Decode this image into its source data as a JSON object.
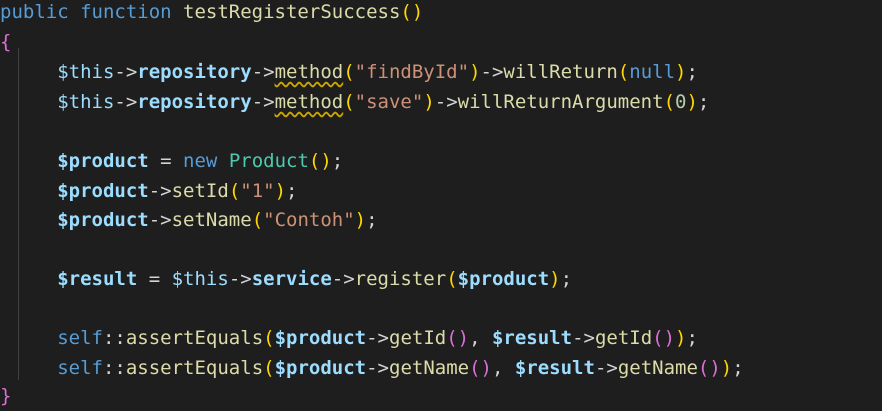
{
  "code": {
    "signature": {
      "kw": "public function",
      "name": "testRegisterSuccess",
      "parens": "()"
    },
    "open_brace": "{",
    "close_brace": "}",
    "l1": {
      "this": "$this",
      "arrow1": "->",
      "repo": "repository",
      "arrow2": "->",
      "method": "method",
      "open": "(",
      "str": "\"findById\"",
      "close": ")",
      "arrow3": "->",
      "call": "willReturn",
      "open2": "(",
      "arg": "null",
      "close2": ")",
      "semi": ";"
    },
    "l2": {
      "this": "$this",
      "arrow1": "->",
      "repo": "repository",
      "arrow2": "->",
      "method": "method",
      "open": "(",
      "str": "\"save\"",
      "close": ")",
      "arrow3": "->",
      "call": "willReturnArgument",
      "open2": "(",
      "arg": "0",
      "close2": ")",
      "semi": ";"
    },
    "l3": {
      "var": "$product",
      "eq": " = ",
      "kw": "new",
      "cls": "Product",
      "parens": "()",
      "semi": ";"
    },
    "l4": {
      "var": "$product",
      "arrow": "->",
      "call": "setId",
      "open": "(",
      "str": "\"1\"",
      "close": ")",
      "semi": ";"
    },
    "l5": {
      "var": "$product",
      "arrow": "->",
      "call": "setName",
      "open": "(",
      "str": "\"Contoh\"",
      "close": ")",
      "semi": ";"
    },
    "l6": {
      "var": "$result",
      "eq": " = ",
      "this": "$this",
      "arrow1": "->",
      "svc": "service",
      "arrow2": "->",
      "call": "register",
      "open": "(",
      "arg": "$product",
      "close": ")",
      "semi": ";"
    },
    "l7": {
      "self": "self",
      "dc": "::",
      "call": "assertEquals",
      "open": "(",
      "v1": "$product",
      "a1": "->",
      "m1": "getId",
      "p1": "()",
      "comma": ", ",
      "v2": "$result",
      "a2": "->",
      "m2": "getId",
      "p2": "()",
      "close": ")",
      "semi": ";"
    },
    "l8": {
      "self": "self",
      "dc": "::",
      "call": "assertEquals",
      "open": "(",
      "v1": "$product",
      "a1": "->",
      "m1": "getName",
      "p1": "()",
      "comma": ", ",
      "v2": "$result",
      "a2": "->",
      "m2": "getName",
      "p2": "()",
      "close": ")",
      "semi": ";"
    }
  },
  "colors": {
    "background": "#1e1e1e",
    "keyword": "#569cd6",
    "function": "#dcdcaa",
    "variable": "#9cdcfe",
    "string": "#ce9178",
    "class": "#4ec9b0",
    "number": "#b5cea8",
    "brace": "#da70d6",
    "paren": "#ffd700"
  }
}
